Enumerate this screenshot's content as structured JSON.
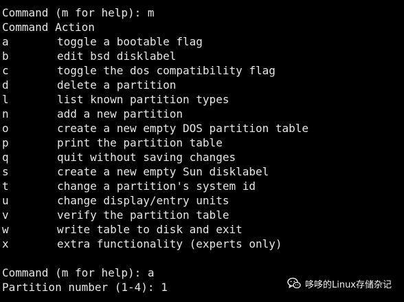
{
  "terminal": {
    "prompt_help": "Command (m for help): m",
    "header": "Command Action",
    "options": [
      {
        "key": "a",
        "desc": "toggle a bootable flag"
      },
      {
        "key": "b",
        "desc": "edit bsd disklabel"
      },
      {
        "key": "c",
        "desc": "toggle the dos compatibility flag"
      },
      {
        "key": "d",
        "desc": "delete a partition"
      },
      {
        "key": "l",
        "desc": "list known partition types"
      },
      {
        "key": "n",
        "desc": "add a new partition"
      },
      {
        "key": "o",
        "desc": "create a new empty DOS partition table"
      },
      {
        "key": "p",
        "desc": "print the partition table"
      },
      {
        "key": "q",
        "desc": "quit without saving changes"
      },
      {
        "key": "s",
        "desc": "create a new empty Sun disklabel"
      },
      {
        "key": "t",
        "desc": "change a partition's system id"
      },
      {
        "key": "u",
        "desc": "change display/entry units"
      },
      {
        "key": "v",
        "desc": "verify the partition table"
      },
      {
        "key": "w",
        "desc": "write table to disk and exit"
      },
      {
        "key": "x",
        "desc": "extra functionality (experts only)"
      }
    ],
    "prompt_cmd": "Command (m for help): a",
    "partition_prompt": "Partition number (1-4): 1"
  },
  "watermark": {
    "text": "哆哆的Linux存储杂记",
    "icon": "wechat-icon"
  },
  "colors": {
    "background": "#000000",
    "text": "#e6e6e6"
  }
}
